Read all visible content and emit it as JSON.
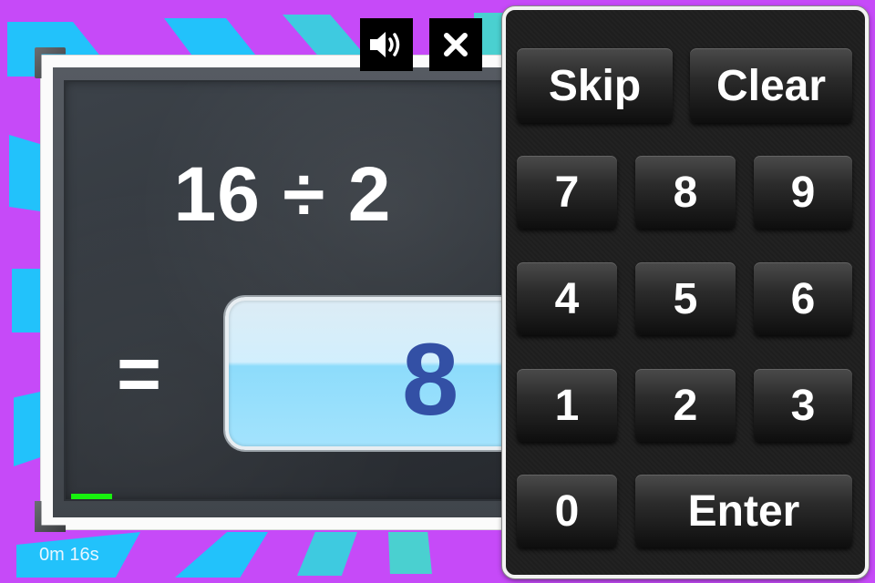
{
  "app": {
    "background_color": "#c64af8",
    "stripe_color": "#22c2fb",
    "stripe_color_alt": "#4ad0d0"
  },
  "toolbar": {
    "sound_icon": "speaker-icon",
    "close_icon": "close-icon"
  },
  "board": {
    "question": "16 ÷ 2",
    "equals": "=",
    "answer": "8",
    "answer_color": "#3350a5",
    "progress_fraction": 0.09,
    "progress_color": "#17f20e"
  },
  "status": {
    "timer": "0m 16s"
  },
  "keypad": {
    "skip_label": "Skip",
    "clear_label": "Clear",
    "keys": [
      "7",
      "8",
      "9",
      "4",
      "5",
      "6",
      "1",
      "2",
      "3",
      "0"
    ],
    "enter_label": "Enter"
  }
}
